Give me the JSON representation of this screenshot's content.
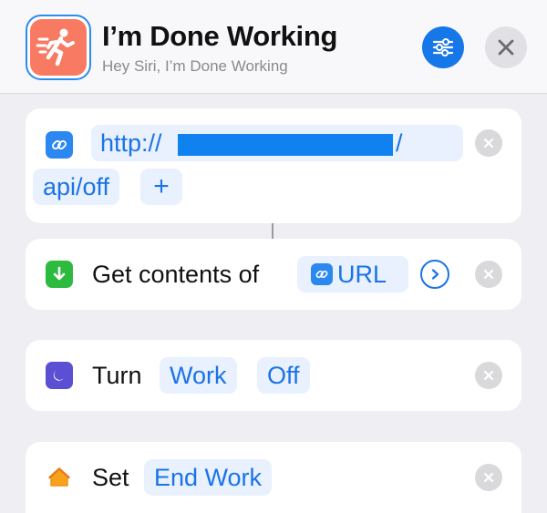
{
  "header": {
    "title": "I’m Done Working",
    "subtitle": "Hey Siri, I’m Done Working",
    "app_icon": "running-figure-icon",
    "settings_icon": "sliders-icon",
    "close_icon": "close-icon",
    "colors": {
      "app_icon_bg": "#f87a63",
      "settings_bg": "#1677e8",
      "accent": "#1a73e8"
    }
  },
  "url_action": {
    "icon": "link-icon",
    "url_prefix": "http://",
    "url_suffix": "/",
    "url_path": "api/off",
    "add_label": "+"
  },
  "get_contents_action": {
    "icon": "download-arrow-icon",
    "label": "Get contents of",
    "variable_icon": "link-icon",
    "variable_label": "URL",
    "expand_icon": "chevron-right-icon"
  },
  "focus_action": {
    "icon": "moon-icon",
    "label": "Turn",
    "focus_value": "Work",
    "state_value": "Off"
  },
  "home_action": {
    "icon": "home-icon",
    "label": "Set",
    "scene_value": "End Work"
  }
}
